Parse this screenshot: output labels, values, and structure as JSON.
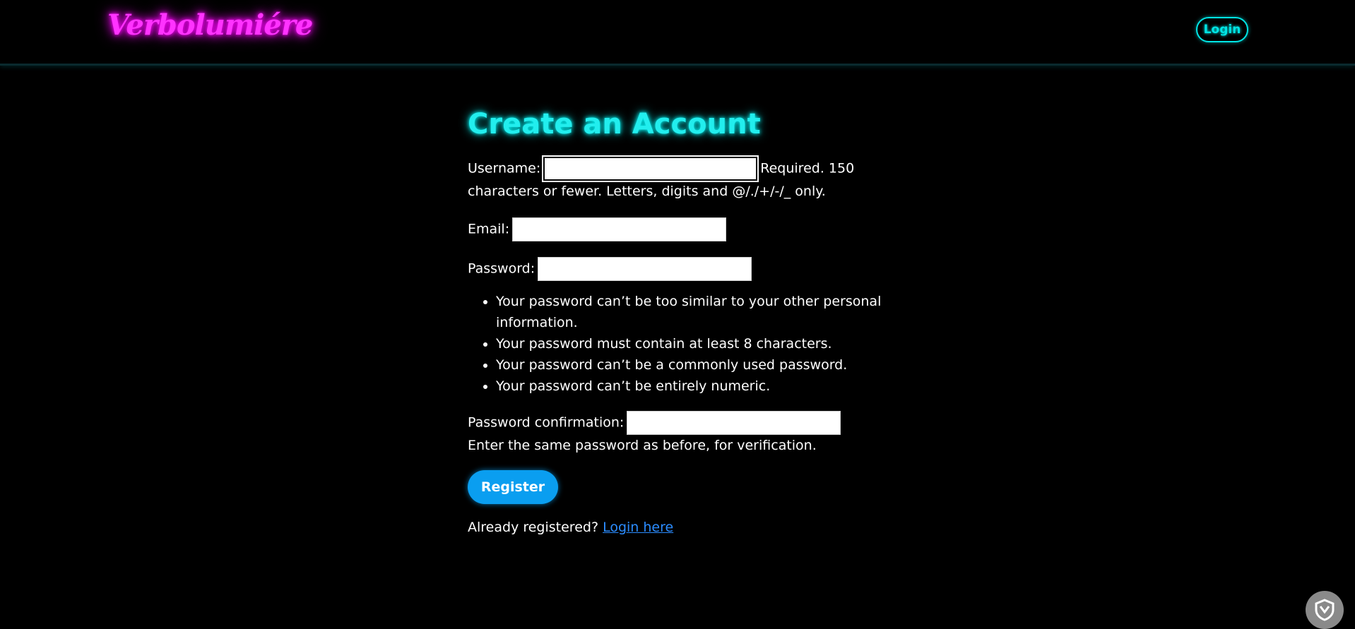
{
  "header": {
    "brand": "Verbolumiére",
    "login_label": "Login"
  },
  "main": {
    "title": "Create an Account",
    "username": {
      "label": "Username:",
      "value": "",
      "help": "Required. 150 characters or fewer. Letters, digits and @/./+/-/_ only."
    },
    "email": {
      "label": "Email:",
      "value": ""
    },
    "password": {
      "label": "Password:",
      "value": "",
      "rules": [
        "Your password can’t be too similar to your other personal information.",
        "Your password must contain at least 8 characters.",
        "Your password can’t be a commonly used password.",
        "Your password can’t be entirely numeric."
      ]
    },
    "password_confirmation": {
      "label": "Password confirmation:",
      "value": "",
      "help": "Enter the same password as before, for verification."
    },
    "register_label": "Register",
    "already_text": "Already registered?",
    "login_here_label": "Login here"
  },
  "widget": {
    "icon": "shield-icon",
    "color": "#8a8a8a"
  },
  "colors": {
    "background": "#000000",
    "brand": "#ff33ff",
    "accent": "#22eeee",
    "button": "#0a9ef0",
    "link": "#2b8cff"
  }
}
